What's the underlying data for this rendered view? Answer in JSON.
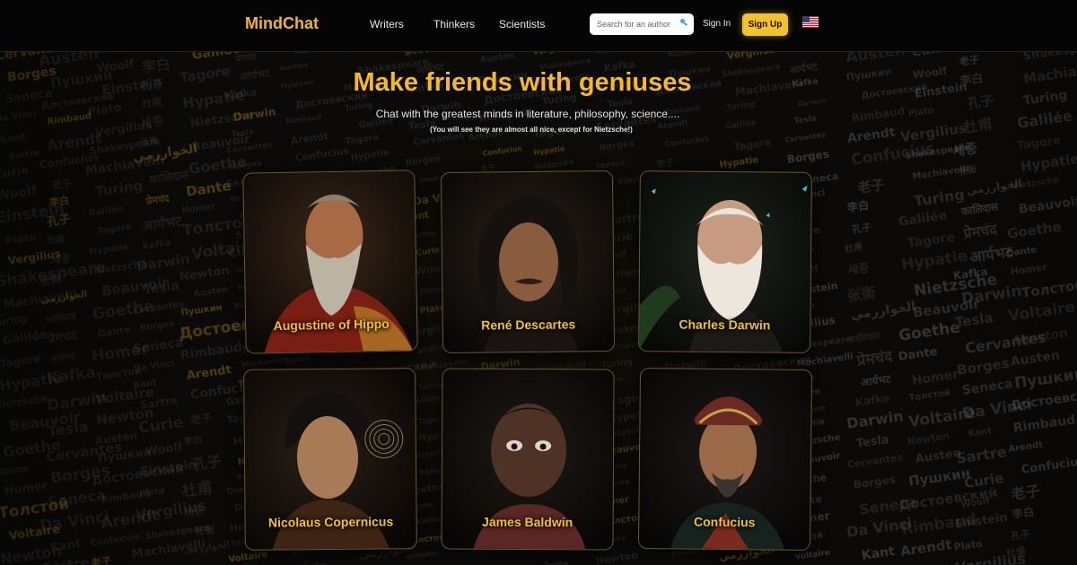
{
  "header": {
    "logo": "MindChat",
    "nav": [
      {
        "label": "Writers"
      },
      {
        "label": "Thinkers"
      },
      {
        "label": "Scientists"
      }
    ],
    "search_placeholder": "Search for an author",
    "signin_label": "Sign In",
    "signup_label": "Sign Up"
  },
  "hero": {
    "title": "Make friends with geniuses",
    "subtitle": "Chat with the greatest minds in literature, philosophy, science....",
    "note": "(You will see they are almost all nice, except for Nietzsche!)"
  },
  "cards": [
    {
      "name": "Augustine of Hippo"
    },
    {
      "name": "René Descartes"
    },
    {
      "name": "Charles Darwin"
    },
    {
      "name": "Nicolaus Copernicus"
    },
    {
      "name": "James Baldwin"
    },
    {
      "name": "Confucius"
    }
  ],
  "colors": {
    "accent": "#f3c12a",
    "background": "#0b0a08",
    "header": "#050505"
  },
  "icons": {
    "search": "search-icon",
    "flag": "us-flag-icon"
  },
  "background_words": [
    "Cervantes",
    "Borges",
    "Seneca",
    "Da Vinci",
    "Kant",
    "Sartre",
    "Curie",
    "Woolf",
    "Einstein",
    "Plato",
    "Vergilius",
    "Shakespeare",
    "Machiavelli",
    "Turing",
    "Galilée",
    "Tagore",
    "Hypatie",
    "Nietzsche",
    "Beauvoir",
    "Goethe",
    "Dante",
    "Homer",
    "Толстой",
    "Voltaire",
    "Newton",
    "Austen",
    "Пушкин",
    "Достоевский",
    "Rimbaud",
    "Arendt",
    "Confucius",
    "老子",
    "李白",
    "孔子",
    "杜甫",
    "세종",
    "张衡",
    "الخوارزمي",
    "कालिदास",
    "प्रेमचंद",
    "आर्यभट",
    "Kafka",
    "Darwin",
    "Tesla"
  ]
}
